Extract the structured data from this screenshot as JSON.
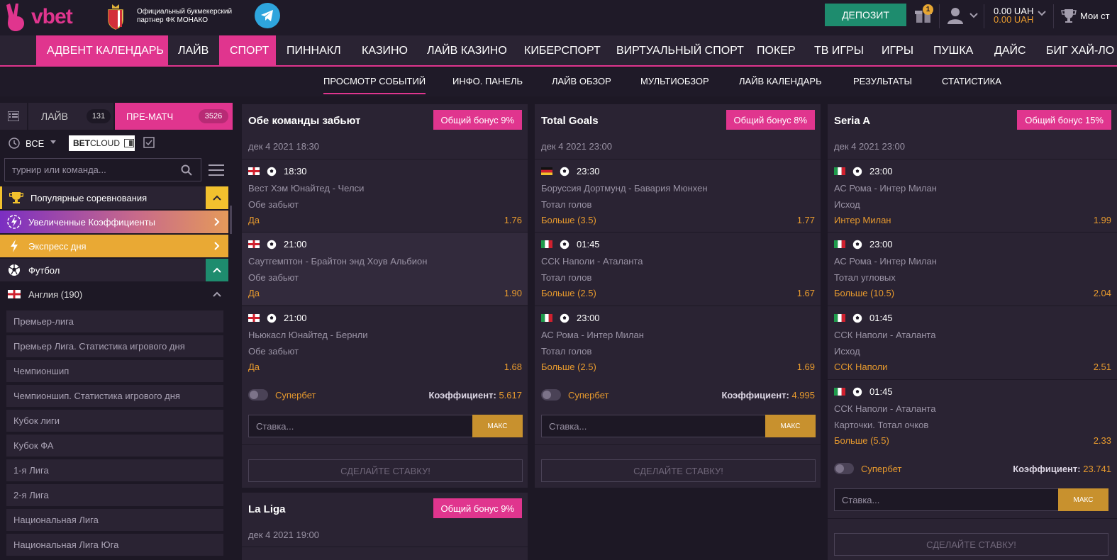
{
  "header": {
    "logo_text": "vbet",
    "partner_line1": "Официальный букмекерский",
    "partner_line2": "партнер ФК МОНАКО",
    "deposit_label": "ДЕПОЗИТ",
    "gift_count": "1",
    "balance_main": "0.00 UAH",
    "balance_bonus": "0.00 UAH",
    "mybets_label": "Мои ст"
  },
  "nav": {
    "items": [
      "АДВЕНТ КАЛЕНДАРЬ",
      "ЛАЙВ",
      "СПОРТ",
      "ПИННАКЛ",
      "КАЗИНО",
      "ЛАЙВ КАЗИНО",
      "КИБЕРСПОРТ",
      "ВИРТУАЛЬНЫЙ СПОРТ",
      "ПОКЕР",
      "ТВ ИГРЫ",
      "ИГРЫ",
      "ПУШКА",
      "ДАЙС",
      "БИГ ХАЙ-ЛО"
    ]
  },
  "subnav": {
    "items": [
      "ПРОСМОТР СОБЫТИЙ",
      "ИНФО. ПАНЕЛЬ",
      "ЛАЙВ ОБЗОР",
      "МУЛЬТИОБЗОР",
      "ЛАЙВ КАЛЕНДАРЬ",
      "РЕЗУЛЬТАТЫ",
      "СТАТИСТИКА"
    ]
  },
  "sidebar": {
    "tab_live": "ЛАЙВ",
    "tab_live_count": "131",
    "tab_prematch": "ПРЕ-МАТЧ",
    "tab_prematch_count": "3526",
    "filter_all": "ВСЕ",
    "betcloud_bold": "BET",
    "betcloud_rest": "CLOUD",
    "search_placeholder": "турнир или команда...",
    "popular": "Популярные соревнования",
    "boosted": "Увеличенные Коэффициенты",
    "express": "Экспресс дня",
    "football": "Футбол",
    "england": "Англия (190)",
    "leagues": [
      "Премьер-лига",
      "Премьер Лига. Статистика игрового дня",
      "Чемпионшип",
      "Чемпионшип. Статистика игрового дня",
      "Кубок лиги",
      "Кубок ФА",
      "1-я Лига",
      "2-я Лига",
      "Национальная Лига",
      "Национальная Лига Юга"
    ]
  },
  "common": {
    "superbet": "Супербет",
    "coef_label": "Коэффициент:",
    "stake_placeholder": "Ставка...",
    "max_label": "МАКС",
    "place_label": "СДЕЛАЙТЕ СТАВКУ!"
  },
  "cards": [
    {
      "title": "Обе команды забьют",
      "bonus": "Общий бонус 9%",
      "date": "дек 4 2021 18:30",
      "coef": "5.617",
      "selections": [
        {
          "flag": "eng",
          "time": "18:30",
          "teams": "Вест Хэм Юнайтед - Челси",
          "market": "Обе забьют",
          "pick": "Да",
          "odd": "1.76"
        },
        {
          "flag": "eng",
          "time": "21:00",
          "teams": "Саутгемптон - Брайтон энд Хоув Альбион",
          "market": "Обе забьют",
          "pick": "Да",
          "odd": "1.90"
        },
        {
          "flag": "eng",
          "time": "21:00",
          "teams": "Ньюкасл Юнайтед - Бернли",
          "market": "Обе забьют",
          "pick": "Да",
          "odd": "1.68"
        }
      ]
    },
    {
      "title": "Total Goals",
      "bonus": "Общий бонус 8%",
      "date": "дек 4 2021 23:00",
      "coef": "4.995",
      "selections": [
        {
          "flag": "ger",
          "time": "23:30",
          "teams": "Боруссия Дортмунд - Бавария Мюнхен",
          "market": "Тотал голов",
          "pick": "Больше (3.5)",
          "odd": "1.77"
        },
        {
          "flag": "ita",
          "time": "01:45",
          "teams": "ССК Наполи - Аталанта",
          "market": "Тотал голов",
          "pick": "Больше (2.5)",
          "odd": "1.67"
        },
        {
          "flag": "ita",
          "time": "23:00",
          "teams": "АС Рома - Интер Милан",
          "market": "Тотал голов",
          "pick": "Больше (2.5)",
          "odd": "1.69"
        }
      ]
    },
    {
      "title": "Seria A",
      "bonus": "Общий бонус 15%",
      "date": "дек 4 2021 23:00",
      "coef": "23.741",
      "selections": [
        {
          "flag": "ita",
          "time": "23:00",
          "teams": "АС Рома - Интер Милан",
          "market": "Исход",
          "pick": "Интер Милан",
          "odd": "1.99"
        },
        {
          "flag": "ita",
          "time": "23:00",
          "teams": "АС Рома - Интер Милан",
          "market": "Тотал угловых",
          "pick": "Больше (10.5)",
          "odd": "2.04"
        },
        {
          "flag": "ita",
          "time": "01:45",
          "teams": "ССК Наполи - Аталанта",
          "market": "Исход",
          "pick": "ССК Наполи",
          "odd": "2.51"
        },
        {
          "flag": "ita",
          "time": "01:45",
          "teams": "ССК Наполи - Аталанта",
          "market": "Карточки. Тотал очков",
          "pick": "Больше (5.5)",
          "odd": "2.33"
        }
      ]
    },
    {
      "title": "La Liga",
      "bonus": "Общий бонус 9%",
      "date": "дек 4 2021 19:00"
    }
  ],
  "colors": {
    "accent": "#e0358e",
    "deposit": "#1e8c6e",
    "odds": "#e79a2e",
    "panel": "#2a2333",
    "bg": "#1d1825"
  }
}
